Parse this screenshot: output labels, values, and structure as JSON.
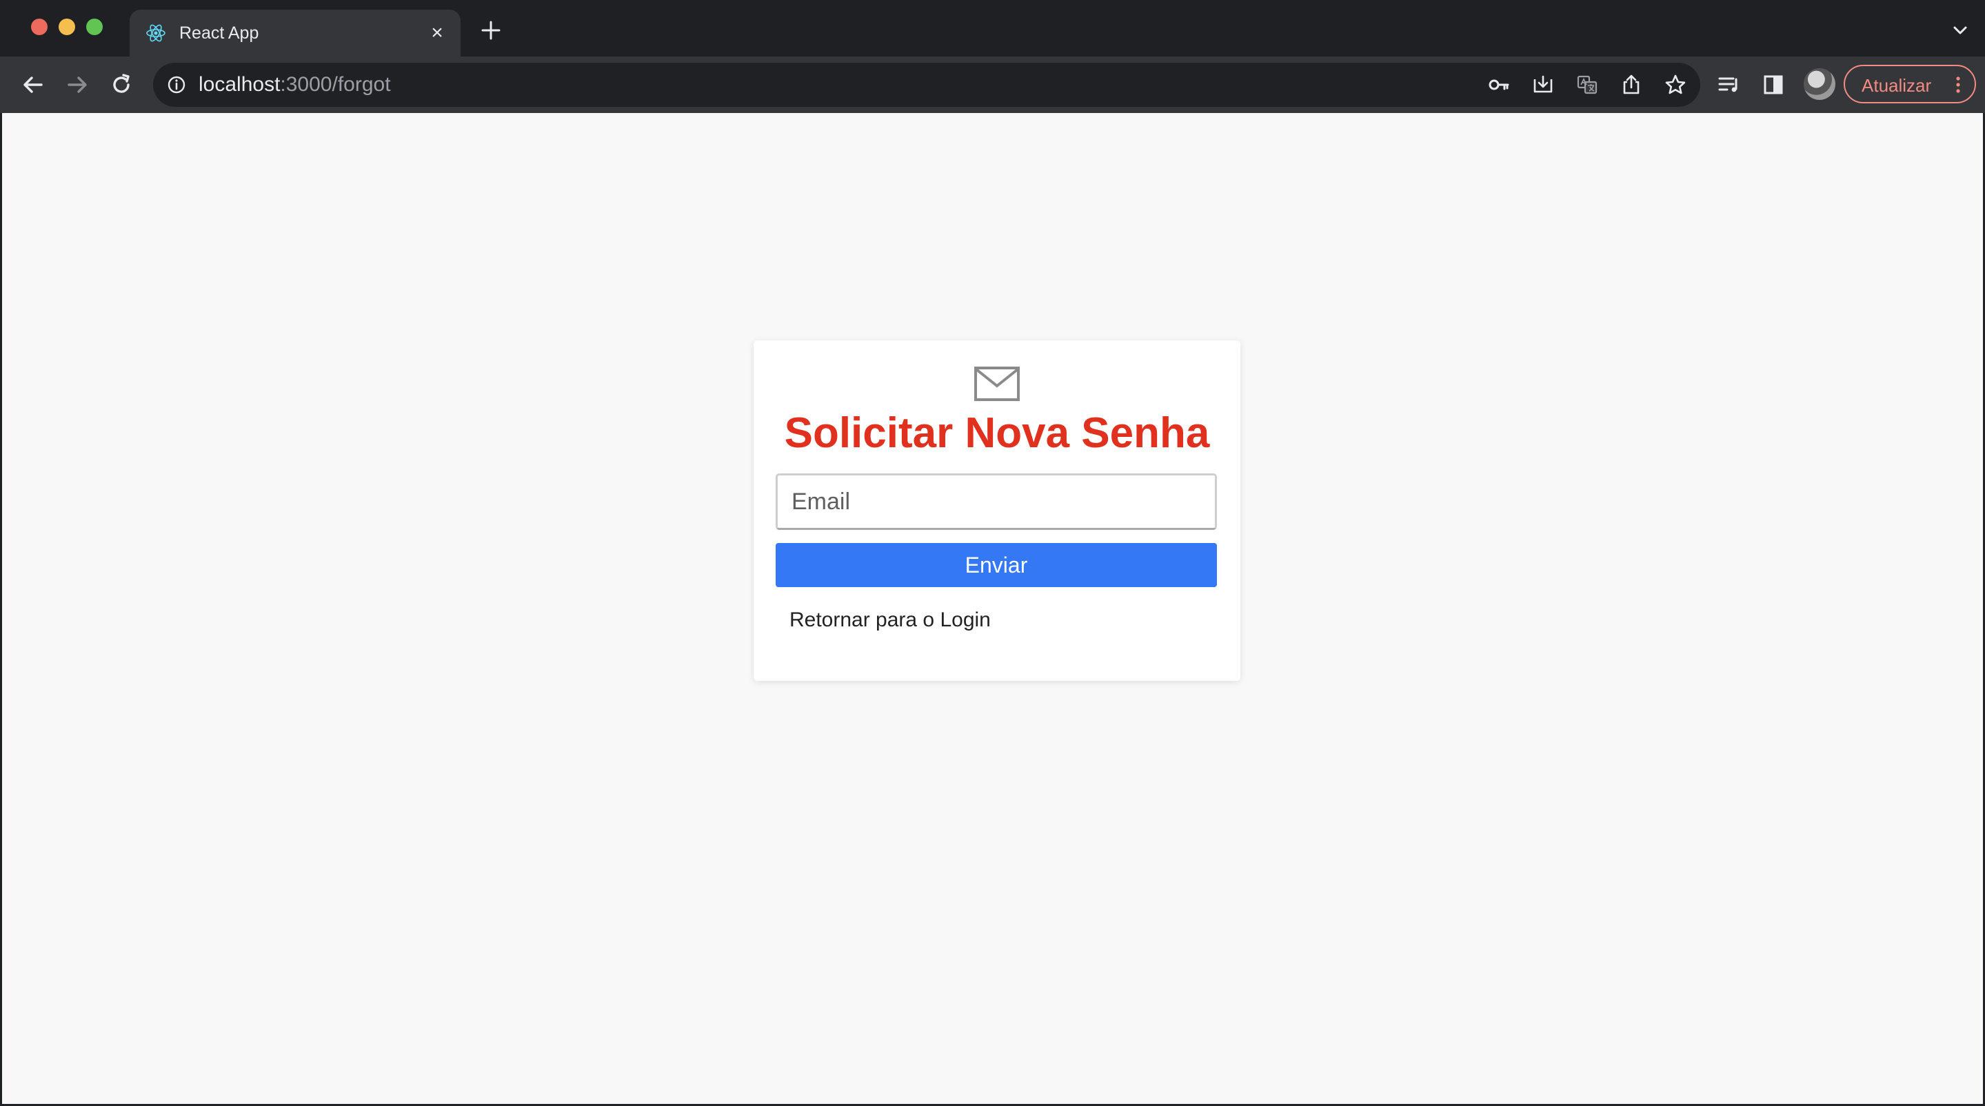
{
  "browser": {
    "tab": {
      "title": "React App",
      "favicon": "react-logo-icon",
      "close_glyph": "×"
    },
    "address": {
      "host": "localhost",
      "path": ":3000/forgot"
    },
    "update_button": {
      "label": "Atualizar"
    },
    "colors": {
      "update_accent": "#f28b82",
      "react_blue": "#61dafb"
    }
  },
  "page": {
    "title": "Solicitar Nova Senha",
    "icon": "envelope-icon",
    "email_input": {
      "value": "",
      "placeholder": "Email"
    },
    "submit_label": "Enviar",
    "back_link_label": "Retornar para o Login",
    "colors": {
      "title": "#e0301e",
      "button": "#3478f6",
      "background": "#f8f8f8",
      "card": "#ffffff"
    }
  }
}
